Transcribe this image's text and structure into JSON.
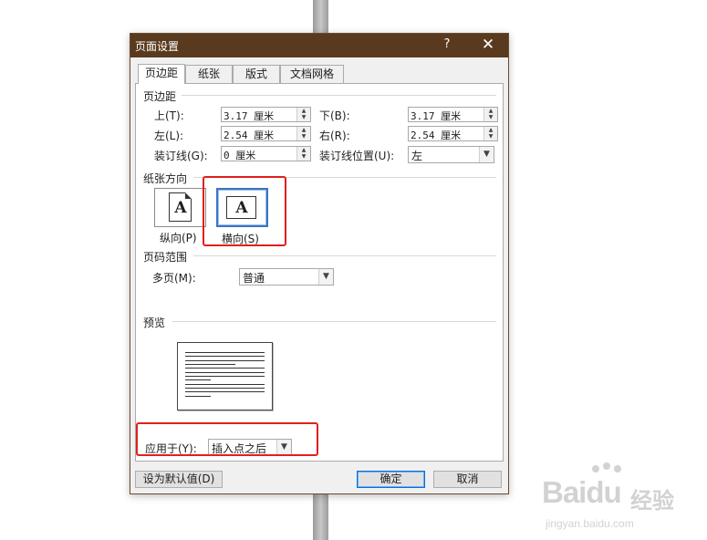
{
  "window": {
    "title": "页面设置",
    "help_label": "?",
    "close_label": "✕"
  },
  "tabs": [
    {
      "label": "页边距"
    },
    {
      "label": "纸张"
    },
    {
      "label": "版式"
    },
    {
      "label": "文档网格"
    }
  ],
  "margins": {
    "section_label": "页边距",
    "top": {
      "label": "上(T):",
      "value": "3.17 厘米"
    },
    "bottom": {
      "label": "下(B):",
      "value": "3.17 厘米"
    },
    "left": {
      "label": "左(L):",
      "value": "2.54 厘米"
    },
    "right": {
      "label": "右(R):",
      "value": "2.54 厘米"
    },
    "gutter": {
      "label": "装订线(G):",
      "value": "0 厘米"
    },
    "gutter_position": {
      "label": "装订线位置(U):",
      "value": "左"
    }
  },
  "orientation": {
    "section_label": "纸张方向",
    "portrait": {
      "label": "纵向(P)",
      "glyph": "A"
    },
    "landscape": {
      "label": "横向(S)",
      "glyph": "A"
    },
    "selected": "landscape"
  },
  "pages": {
    "section_label": "页码范围",
    "multiple_label": "多页(M):",
    "multiple_value": "普通"
  },
  "preview": {
    "section_label": "预览"
  },
  "apply": {
    "label": "应用于(Y):",
    "value": "插入点之后"
  },
  "buttons": {
    "default_label": "设为默认值(D)",
    "ok_label": "确定",
    "cancel_label": "取消"
  },
  "watermark": {
    "brand": "Baidu",
    "brand_cn": "经验",
    "url": "jingyan.baidu.com"
  },
  "colors": {
    "titlebar": "#5a3a1e",
    "highlight": "#e0201d",
    "selected_border": "#3b75c4"
  }
}
